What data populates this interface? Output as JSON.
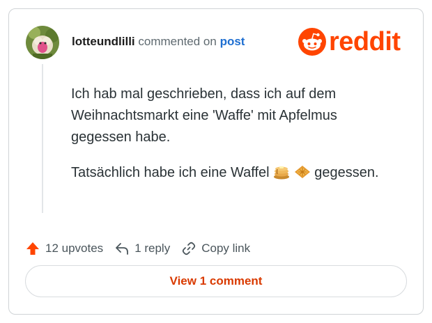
{
  "comment": {
    "username": "lotteundlilli",
    "action_text": "commented on",
    "post_link": "post",
    "paragraph_1": "Ich hab mal geschrieben, dass ich auf dem Weihnachtsmarkt eine 'Waffe' mit Apfelmus gegessen habe.",
    "paragraph_2_before": "Tatsächlich habe ich eine Waffel",
    "paragraph_2_after": "gegessen.",
    "emojis": [
      "pancakes-emoji",
      "waffle-emoji"
    ]
  },
  "brand": {
    "wordmark": "reddit",
    "color": "#ff4500"
  },
  "actions": {
    "upvotes_label": "12 upvotes",
    "reply_label": "1 reply",
    "copy_link_label": "Copy link"
  },
  "footer": {
    "view_comments_label": "View 1 comment",
    "accent_color": "#d93a00"
  },
  "icons": {
    "upvote": "upvote-arrow-icon",
    "reply": "reply-arrow-icon",
    "copy_link": "link-icon"
  }
}
